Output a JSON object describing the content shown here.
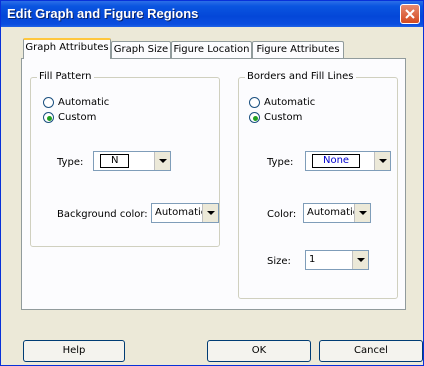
{
  "dialog": {
    "title": "Edit Graph and Figure Regions"
  },
  "tabs": [
    {
      "label": "Graph Attributes",
      "active": true
    },
    {
      "label": "Graph Size",
      "active": false
    },
    {
      "label": "Figure Location",
      "active": false
    },
    {
      "label": "Figure Attributes",
      "active": false
    }
  ],
  "fill_pattern": {
    "legend": "Fill Pattern",
    "radio_automatic": "Automatic",
    "radio_custom": "Custom",
    "selected": "Custom",
    "type_label": "Type:",
    "type_value": "N",
    "background_label": "Background color:",
    "background_value": "Automatic"
  },
  "borders": {
    "legend": "Borders and Fill Lines",
    "radio_automatic": "Automatic",
    "radio_custom": "Custom",
    "selected": "Custom",
    "type_label": "Type:",
    "type_value": "None",
    "color_label": "Color:",
    "color_value": "Automatic",
    "size_label": "Size:",
    "size_value": "1"
  },
  "buttons": {
    "help": "Help",
    "ok": "OK",
    "cancel": "Cancel"
  }
}
